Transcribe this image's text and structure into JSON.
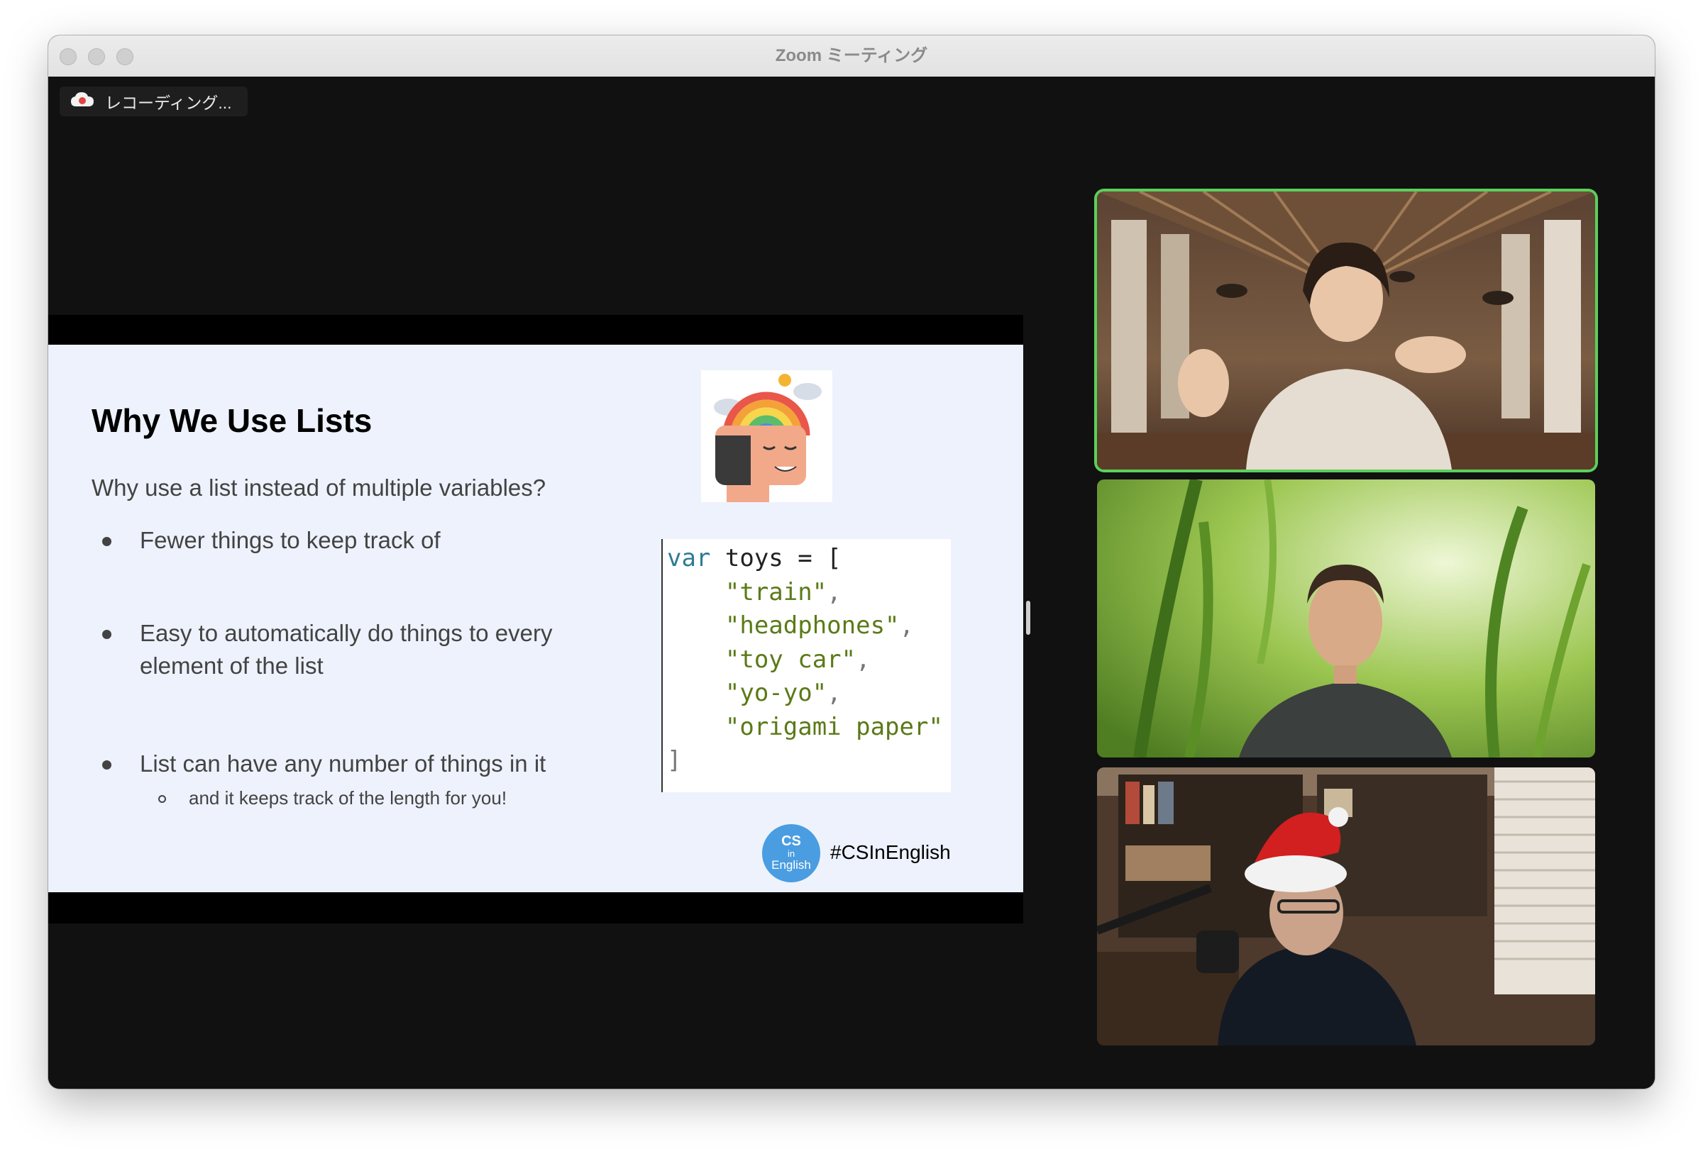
{
  "window": {
    "title": "Zoom ミーティング",
    "recording_label": "レコーディング..."
  },
  "slide": {
    "title": "Why We Use Lists",
    "subtitle": "Why use a list instead of multiple variables?",
    "bullets": [
      "Fewer things to keep track of",
      "Easy to automatically do things to every element of the list",
      "List can have any number of things in it"
    ],
    "subbullet": "and it keeps track of the length for you!",
    "code": {
      "line1_kw": "var",
      "line1_rest": " toys = [",
      "items": [
        "\"train\"",
        "\"headphones\"",
        "\"toy car\"",
        "\"yo-yo\"",
        "\"origami paper\""
      ],
      "closing": "]"
    },
    "logo_text": [
      "CS",
      "in",
      "English"
    ],
    "hashtag": "#CSInEnglish"
  },
  "participants": [
    {
      "icon": "participant-video-1",
      "active": true
    },
    {
      "icon": "participant-video-2",
      "active": false
    },
    {
      "icon": "participant-video-3",
      "active": false
    }
  ],
  "colors": {
    "active_speaker_border": "#5bd05b",
    "slide_background": "#edf2fc",
    "record_icon": "#e0463e"
  }
}
